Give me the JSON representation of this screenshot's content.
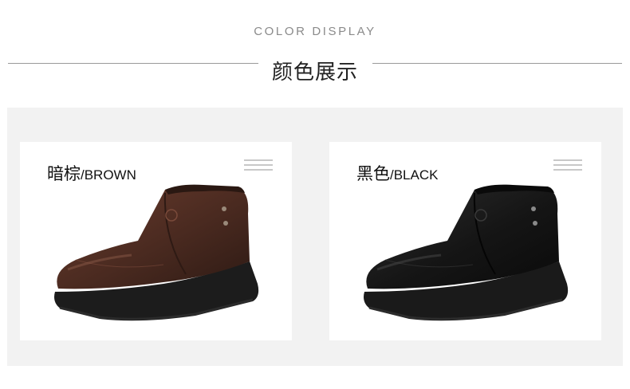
{
  "header": {
    "title_en": "COLOR DISPLAY",
    "title_cn": "颜色展示"
  },
  "variants": [
    {
      "name_cn": "暗棕",
      "name_en": "/BROWN",
      "color": "#4a2a20",
      "highlight": "#6a3c2e",
      "icon": "menu-lines-icon",
      "image": "brown-boot-image"
    },
    {
      "name_cn": "黑色",
      "name_en": "/BLACK",
      "color": "#151515",
      "highlight": "#2e2e2e",
      "icon": "menu-lines-icon",
      "image": "black-boot-image"
    }
  ]
}
